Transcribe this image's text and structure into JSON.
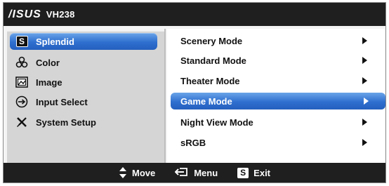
{
  "header": {
    "brand": "/ISUS",
    "model": "VH238"
  },
  "left_menu": [
    {
      "label": "Splendid",
      "icon": "splendid-s-icon",
      "selected": true
    },
    {
      "label": "Color",
      "icon": "color-icon",
      "selected": false
    },
    {
      "label": "Image",
      "icon": "image-icon",
      "selected": false
    },
    {
      "label": "Input Select",
      "icon": "input-select-icon",
      "selected": false
    },
    {
      "label": "System Setup",
      "icon": "system-setup-icon",
      "selected": false
    }
  ],
  "right_menu": [
    {
      "label": "Scenery Mode",
      "selected": false
    },
    {
      "label": "Standard Mode",
      "selected": false
    },
    {
      "label": "Theater Mode",
      "selected": false
    },
    {
      "label": "Game Mode",
      "selected": true
    },
    {
      "label": "Night View Mode",
      "selected": false
    },
    {
      "label": "sRGB",
      "selected": false
    }
  ],
  "footer": {
    "move_label": "Move",
    "menu_label": "Menu",
    "exit_label": "Exit"
  },
  "icons": {
    "s_letter": "S"
  },
  "colors": {
    "highlight": "#2f6fcf",
    "bar": "#1f1f1f"
  }
}
